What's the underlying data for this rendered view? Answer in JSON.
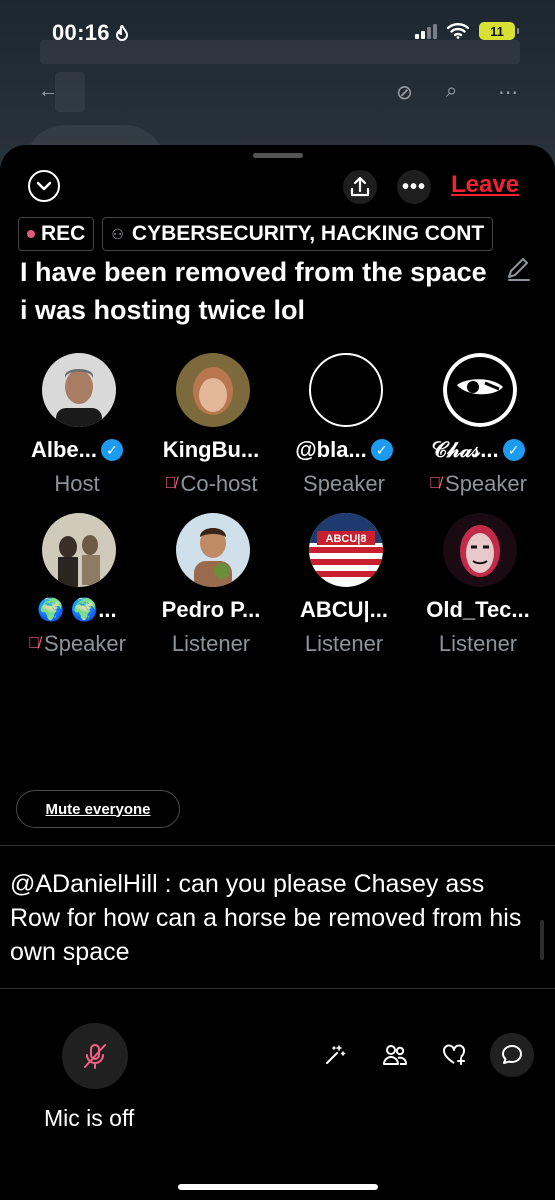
{
  "status_bar": {
    "time": "00:16",
    "battery": "11"
  },
  "header": {
    "leave_label": "Leave"
  },
  "tags": {
    "rec_label": "REC",
    "topic_label": "CYBERSECURITY, HACKING CONT"
  },
  "space_title": "I have been removed from the space i was hosting twice lol",
  "participants": [
    {
      "name": "Albe...",
      "role": "Host",
      "verified": true,
      "muted": false
    },
    {
      "name": "KingBu...",
      "role": "Co-host",
      "verified": false,
      "muted": true
    },
    {
      "name": "@bla...",
      "role": "Speaker",
      "verified": true,
      "muted": false
    },
    {
      "name": "𝒞𝒽𝒶𝓈...",
      "role": "Speaker",
      "verified": true,
      "muted": true
    },
    {
      "name": "🌍 🌍...",
      "role": "Speaker",
      "verified": false,
      "muted": true
    },
    {
      "name": "Pedro P...",
      "role": "Listener",
      "verified": false,
      "muted": false
    },
    {
      "name": "ABCU|...",
      "role": "Listener",
      "verified": false,
      "muted": false
    },
    {
      "name": "Old_Tec...",
      "role": "Listener",
      "verified": false,
      "muted": false
    }
  ],
  "avatar_art": {
    "abcu_text": "ABCU|8"
  },
  "mute_everyone_label": "Mute everyone",
  "comment": "@ADanielHill :  can you please Chasey ass Row for how can a horse be removed from his own space",
  "mic_label": "Mic is off",
  "colors": {
    "leave": "#f4212e",
    "verified": "#1d9bf0",
    "mic_off": "#f4618a",
    "rec_dot": "#e45a7e"
  },
  "icons": [
    "chevron-down-icon",
    "share-icon",
    "more-icon",
    "edit-icon",
    "mic-off-icon",
    "sparkles-icon",
    "people-icon",
    "heart-plus-icon",
    "chat-icon"
  ]
}
